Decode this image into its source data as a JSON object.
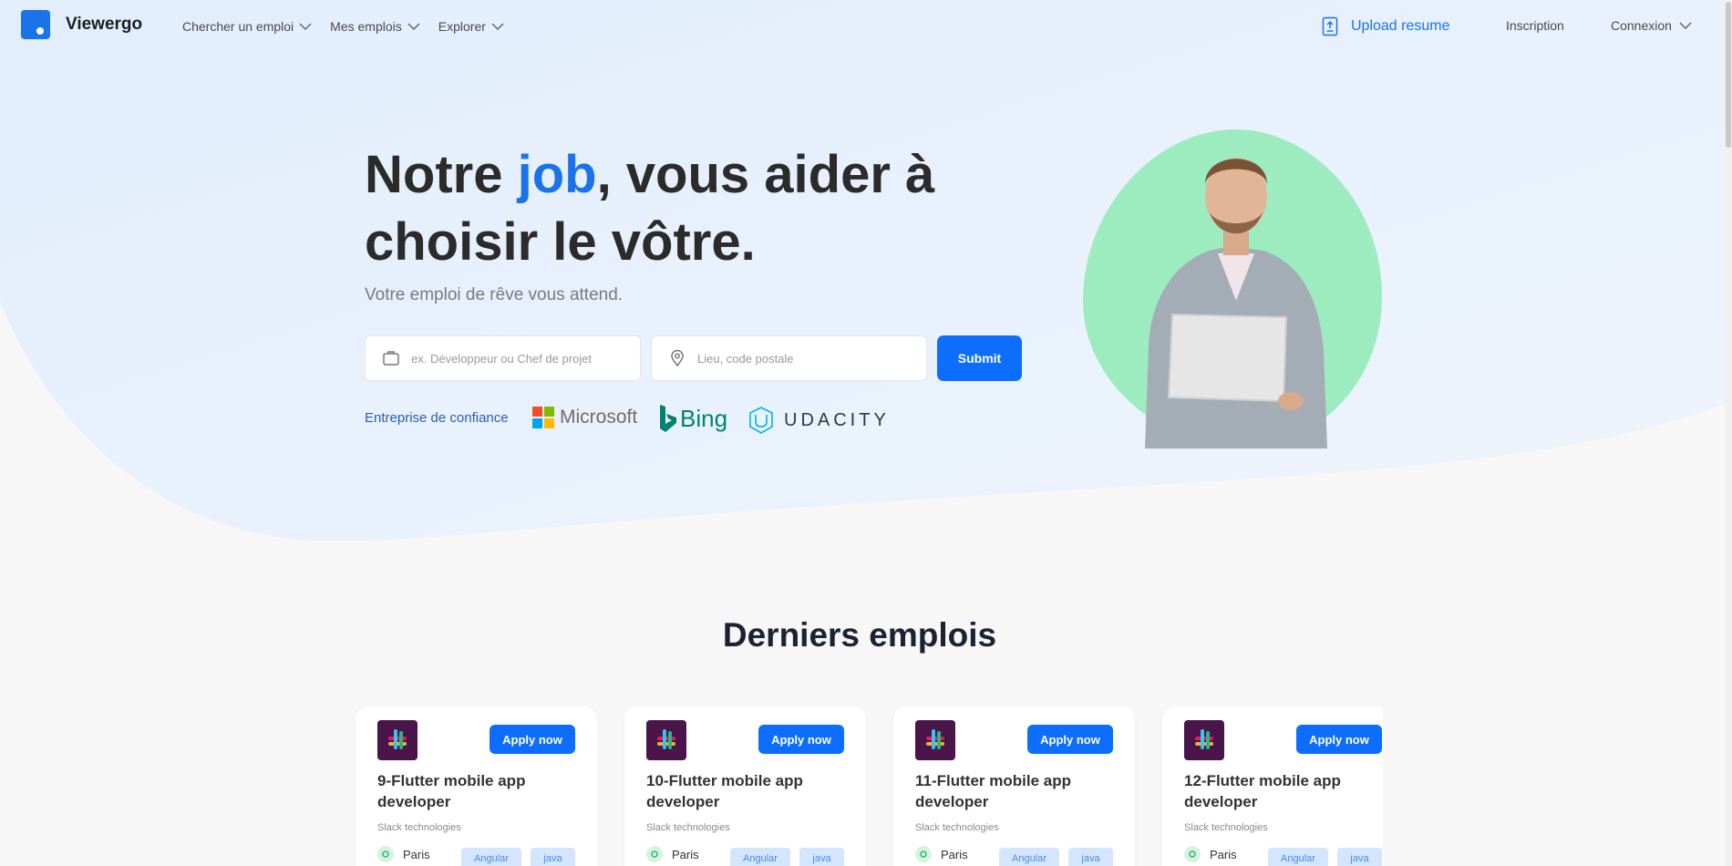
{
  "brand": "Viewergo",
  "nav": {
    "items": [
      {
        "label": "Chercher un emploi"
      },
      {
        "label": "Mes emplois"
      },
      {
        "label": "Explorer"
      }
    ],
    "upload_label": "Upload resume",
    "signup_label": "Inscription",
    "login_label": "Connexion"
  },
  "hero": {
    "title_part1": "Notre ",
    "title_accent": "job",
    "title_part2": ", vous aider à choisir le vôtre.",
    "subtitle": "Votre emploi de rêve vous attend.",
    "job_placeholder": "ex. Développeur ou Chef de projet",
    "location_placeholder": "Lieu, code postale",
    "submit_label": "Submit",
    "trusted_label": "Entreprise de confiance",
    "trusted_logos": [
      "Microsoft",
      "Bing",
      "UDACITY"
    ]
  },
  "section": {
    "title": "Derniers emplois"
  },
  "jobs": [
    {
      "title": "9-Flutter mobile app developer",
      "company": "Slack technologies",
      "location": "Paris",
      "tags": [
        "Angular",
        "java"
      ],
      "apply_label": "Apply now"
    },
    {
      "title": "10-Flutter mobile app developer",
      "company": "Slack technologies",
      "location": "Paris",
      "tags": [
        "Angular",
        "java"
      ],
      "apply_label": "Apply now"
    },
    {
      "title": "11-Flutter mobile app developer",
      "company": "Slack technologies",
      "location": "Paris",
      "tags": [
        "Angular",
        "java"
      ],
      "apply_label": "Apply now"
    },
    {
      "title": "12-Flutter mobile app developer",
      "company": "Slack technologies",
      "location": "Paris",
      "tags": [
        "Angular",
        "java"
      ],
      "apply_label": "Apply now"
    }
  ],
  "colors": {
    "accent": "#1a73e8",
    "button": "#0d6efd",
    "hero_bg": "#e6f1fd",
    "blob": "#9cecbf",
    "slack_bg": "#4a154b"
  }
}
